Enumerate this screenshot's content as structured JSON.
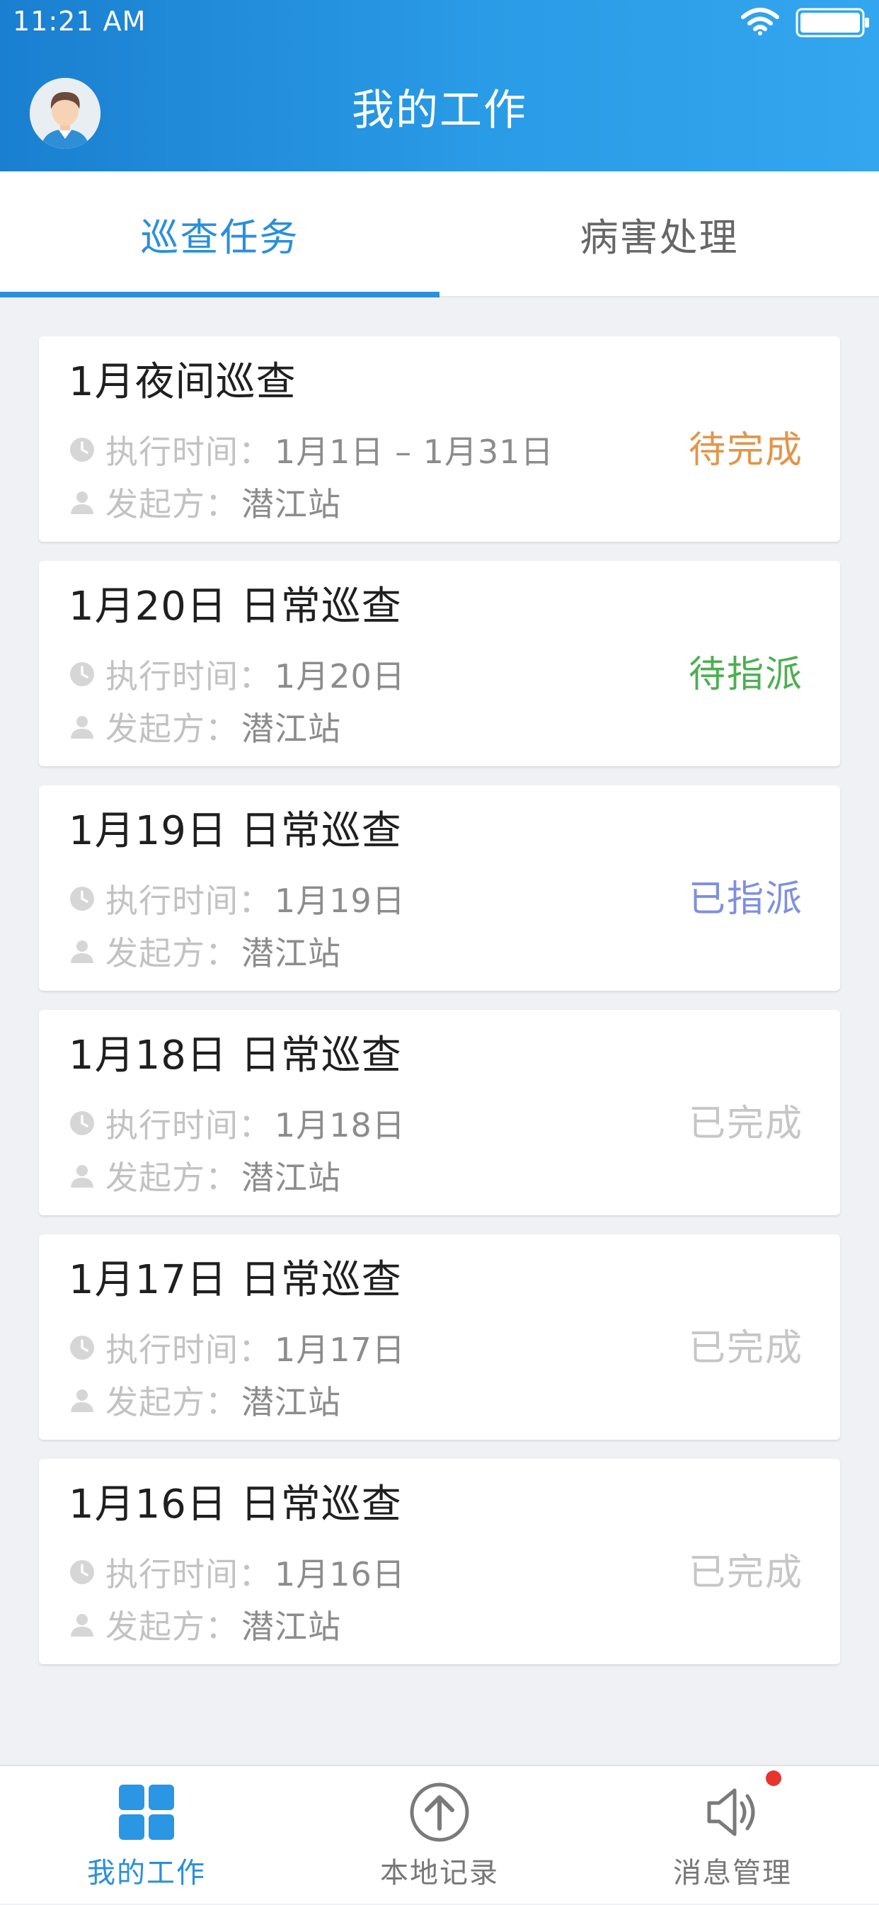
{
  "status_bar": {
    "time": "11:21 AM"
  },
  "header": {
    "title": "我的工作"
  },
  "tabs": [
    {
      "label": "巡查任务",
      "active": true
    },
    {
      "label": "病害处理",
      "active": false
    }
  ],
  "labels": {
    "exec_time": "执行时间：",
    "initiator": "发起方："
  },
  "tasks": [
    {
      "title": "1月夜间巡查",
      "exec_time": "1月1日 – 1月31日",
      "initiator": "潜江站",
      "status": "待完成",
      "status_color": "#e2954a"
    },
    {
      "title": "1月20日 日常巡查",
      "exec_time": "1月20日",
      "initiator": "潜江站",
      "status": "待指派",
      "status_color": "#4caf50"
    },
    {
      "title": "1月19日 日常巡查",
      "exec_time": "1月19日",
      "initiator": "潜江站",
      "status": "已指派",
      "status_color": "#7f8fe0"
    },
    {
      "title": "1月18日 日常巡查",
      "exec_time": "1月18日",
      "initiator": "潜江站",
      "status": "已完成",
      "status_color": "#c6c6c6"
    },
    {
      "title": "1月17日 日常巡查",
      "exec_time": "1月17日",
      "initiator": "潜江站",
      "status": "已完成",
      "status_color": "#c6c6c6"
    },
    {
      "title": "1月16日 日常巡查",
      "exec_time": "1月16日",
      "initiator": "潜江站",
      "status": "已完成",
      "status_color": "#c6c6c6"
    }
  ],
  "bottom_nav": [
    {
      "label": "我的工作",
      "icon": "grid-icon",
      "active": true
    },
    {
      "label": "本地记录",
      "icon": "upload-circle-icon",
      "active": false
    },
    {
      "label": "消息管理",
      "icon": "speaker-icon",
      "active": false,
      "has_badge": true
    }
  ],
  "colors": {
    "accent": "#2a8fdc",
    "header_start": "#1a7fd0",
    "header_end": "#33a6ef",
    "badge": "#e8342f"
  }
}
